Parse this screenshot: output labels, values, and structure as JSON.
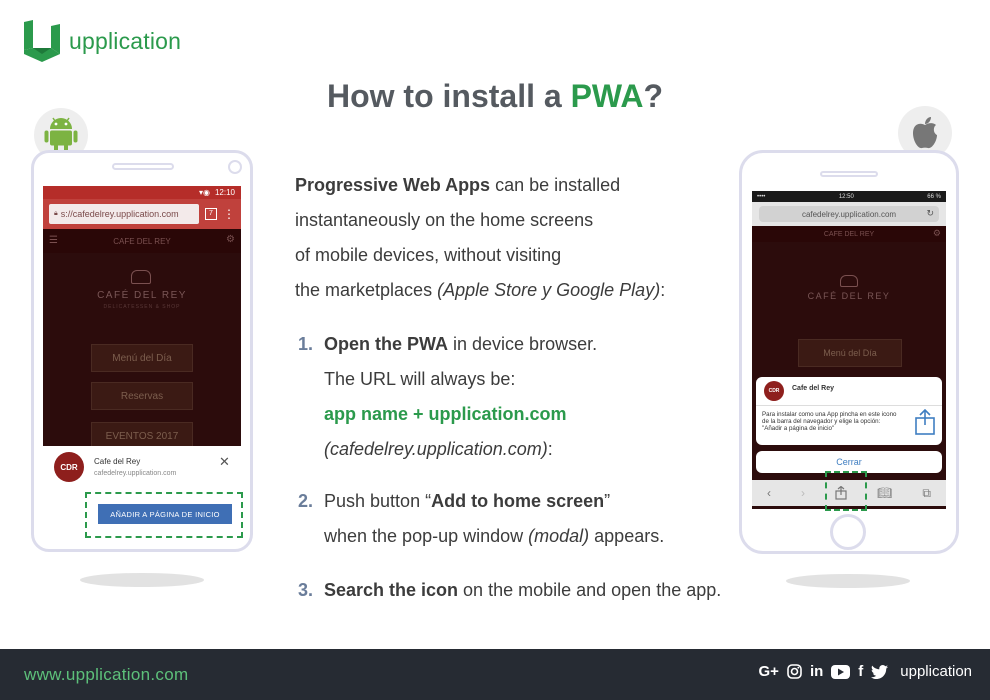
{
  "brand": {
    "logo_text": "upplication",
    "color_green": "#2b9a4c"
  },
  "headline": {
    "prefix": "How to install a ",
    "highlight": "PWA",
    "suffix": "?"
  },
  "intro": {
    "bold": "Progressive Web Apps",
    "line1_rest": " can be installed",
    "line2": "instantaneously on the home screens",
    "line3": "of mobile devices, without visiting",
    "line4_prefix": "the marketplaces ",
    "line4_italic": "(Apple Store y Google Play)",
    "line4_suffix": ":"
  },
  "steps": [
    {
      "num": "1.",
      "line1_bold": "Open the PWA",
      "line1_rest": " in device browser.",
      "line2": "The URL will always be:",
      "line3": "app name + upplication.com",
      "line4_italic": "(cafedelrey.upplication.com)",
      "line4_suffix": ":"
    },
    {
      "num": "2.",
      "line1_prefix": "Push button “",
      "line1_bold": "Add to home screen",
      "line1_suffix": "”",
      "line2_prefix": "when the pop-up window ",
      "line2_italic": "(modal)",
      "line2_suffix": " appears."
    },
    {
      "num": "3.",
      "line1_bold": "Search the icon",
      "line1_rest": " on the mobile and open the app."
    }
  ],
  "android": {
    "icon": "android-icon",
    "status_time": "12:10",
    "url": "s://cafedelrey.upplication.com",
    "tabs_count": "7",
    "app_title": "CAFE DEL REY",
    "brand_name": "CAFÉ DEL REY",
    "brand_sub": "DELICATESSEN & SHOP",
    "buttons": [
      "Menú del Día",
      "Reservas",
      "EVENTOS 2017"
    ],
    "sheet_logo": "CDR",
    "sheet_name": "Cafe del Rey",
    "sheet_url": "cafedelrey.upplication.com",
    "add_button": "AÑADIR A PÁGINA DE INICIO"
  },
  "iphone": {
    "icon": "apple-icon",
    "status_left": "••••",
    "status_time": "12:50",
    "status_right": "66 %",
    "url": "cafedelrey.upplication.com",
    "app_title": "CAFE DEL REY",
    "brand_name": "CAFÉ DEL REY",
    "menu_button": "Menú del Día",
    "modal_logo": "CDR",
    "modal_name": "Cafe del Rey",
    "modal_text": "Para instalar como una App pincha en este icono de la barra del navegador y elige la opción: \"Añadir a página de inicio\"",
    "close_button": "Cerrar"
  },
  "footer": {
    "url": "www.upplication.com",
    "social": [
      "G+",
      "instagram-icon",
      "in",
      "youtube-icon",
      "f",
      "twitter-icon"
    ],
    "social_gplus": "G+",
    "social_in": "in",
    "social_f": "f",
    "brand": "upplication"
  }
}
